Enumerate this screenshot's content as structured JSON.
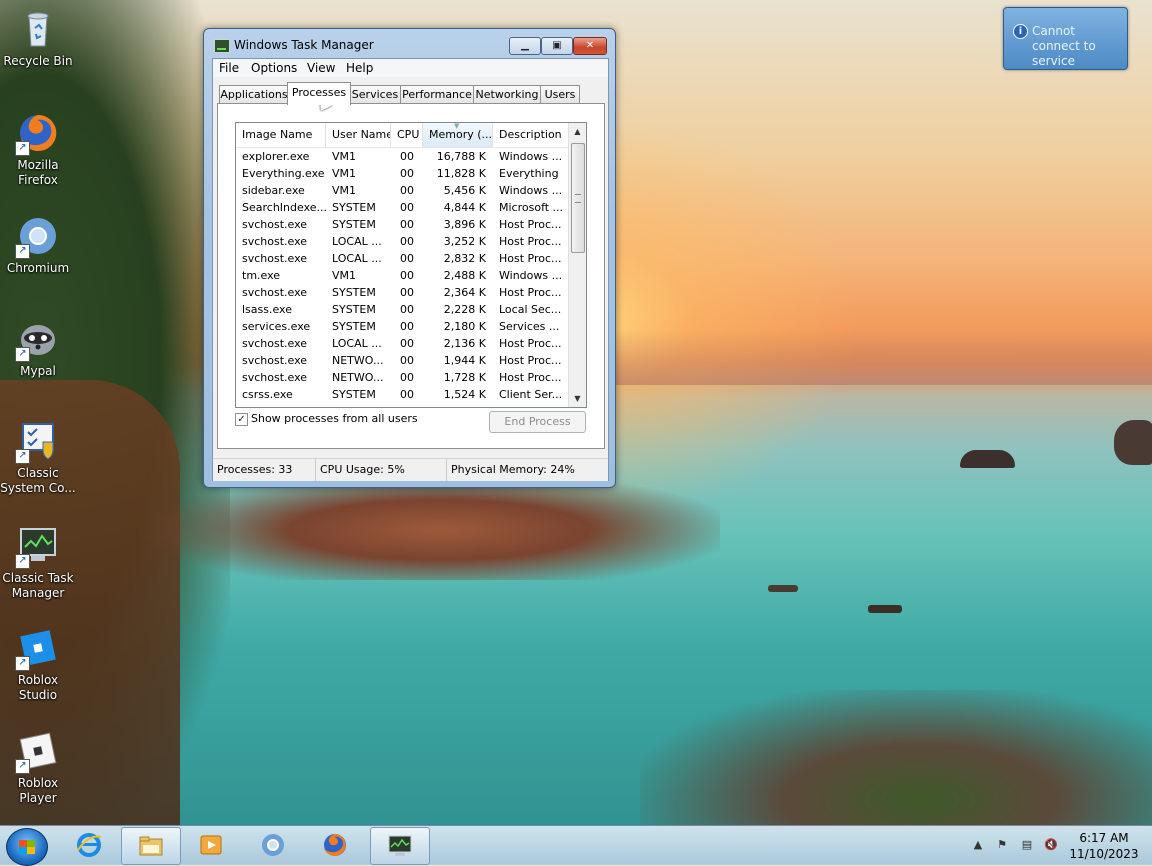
{
  "desktop": {
    "icons": [
      {
        "label": "Recycle Bin"
      },
      {
        "label": "Mozilla Firefox"
      },
      {
        "label": "Chromium"
      },
      {
        "label": "Mypal"
      },
      {
        "label": "Classic System Co..."
      },
      {
        "label": "Classic Task Manager"
      },
      {
        "label": "Roblox Studio"
      },
      {
        "label": "Roblox Player"
      }
    ]
  },
  "notification": {
    "message": "Cannot connect to service"
  },
  "window": {
    "title": "Windows Task Manager",
    "menu": [
      "File",
      "Options",
      "View",
      "Help"
    ],
    "tabs": [
      "Applications",
      "Processes",
      "Services",
      "Performance",
      "Networking",
      "Users"
    ],
    "active_tab": "Processes",
    "columns": [
      "Image Name",
      "User Name",
      "CPU",
      "Memory (...",
      "Description"
    ],
    "processes": [
      {
        "name": "explorer.exe",
        "user": "VM1",
        "cpu": "00",
        "mem": "16,788 K",
        "desc": "Windows ..."
      },
      {
        "name": "Everything.exe",
        "user": "VM1",
        "cpu": "00",
        "mem": "11,828 K",
        "desc": "Everything"
      },
      {
        "name": "sidebar.exe",
        "user": "VM1",
        "cpu": "00",
        "mem": "5,456 K",
        "desc": "Windows ..."
      },
      {
        "name": "SearchIndexe...",
        "user": "SYSTEM",
        "cpu": "00",
        "mem": "4,844 K",
        "desc": "Microsoft ..."
      },
      {
        "name": "svchost.exe",
        "user": "SYSTEM",
        "cpu": "00",
        "mem": "3,896 K",
        "desc": "Host Proc..."
      },
      {
        "name": "svchost.exe",
        "user": "LOCAL ...",
        "cpu": "00",
        "mem": "3,252 K",
        "desc": "Host Proc..."
      },
      {
        "name": "svchost.exe",
        "user": "LOCAL ...",
        "cpu": "00",
        "mem": "2,832 K",
        "desc": "Host Proc..."
      },
      {
        "name": "tm.exe",
        "user": "VM1",
        "cpu": "00",
        "mem": "2,488 K",
        "desc": "Windows ..."
      },
      {
        "name": "svchost.exe",
        "user": "SYSTEM",
        "cpu": "00",
        "mem": "2,364 K",
        "desc": "Host Proc..."
      },
      {
        "name": "lsass.exe",
        "user": "SYSTEM",
        "cpu": "00",
        "mem": "2,228 K",
        "desc": "Local Sec..."
      },
      {
        "name": "services.exe",
        "user": "SYSTEM",
        "cpu": "00",
        "mem": "2,180 K",
        "desc": "Services ..."
      },
      {
        "name": "svchost.exe",
        "user": "LOCAL ...",
        "cpu": "00",
        "mem": "2,136 K",
        "desc": "Host Proc..."
      },
      {
        "name": "svchost.exe",
        "user": "NETWO...",
        "cpu": "00",
        "mem": "1,944 K",
        "desc": "Host Proc..."
      },
      {
        "name": "svchost.exe",
        "user": "NETWO...",
        "cpu": "00",
        "mem": "1,728 K",
        "desc": "Host Proc..."
      },
      {
        "name": "csrss.exe",
        "user": "SYSTEM",
        "cpu": "00",
        "mem": "1,524 K",
        "desc": "Client Ser..."
      }
    ],
    "show_all_label": "Show processes from all users",
    "show_all_checked": true,
    "end_process_label": "End Process",
    "status": {
      "processes": "Processes: 33",
      "cpu": "CPU Usage: 5%",
      "memory": "Physical Memory: 24%"
    }
  },
  "taskbar": {
    "pinned": [
      "internet-explorer",
      "file-explorer",
      "media-player",
      "chromium",
      "firefox",
      "task-manager"
    ],
    "clock_time": "6:17 AM",
    "clock_date": "11/10/2023"
  }
}
